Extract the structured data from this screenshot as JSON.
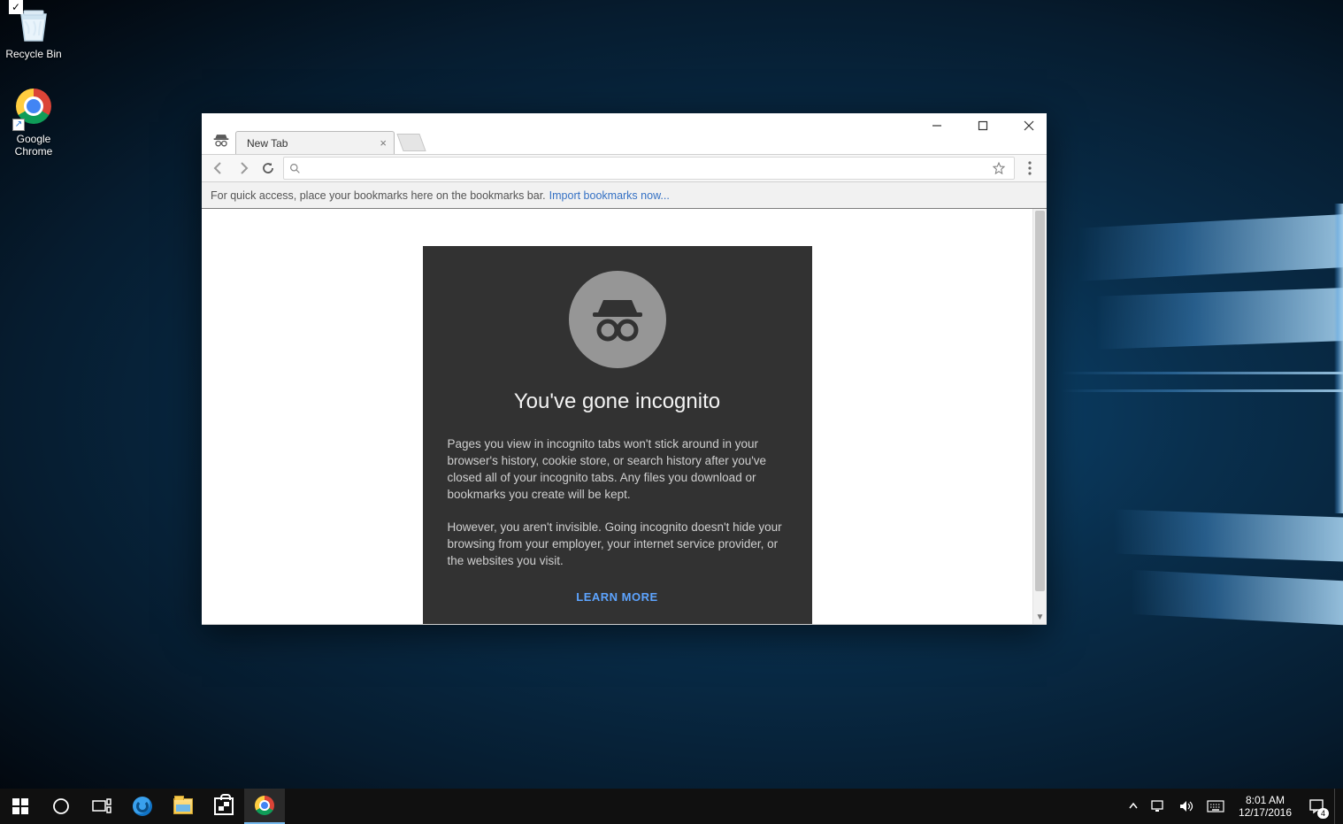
{
  "desktop": {
    "icons": [
      {
        "name": "recycle-bin",
        "label": "Recycle Bin"
      },
      {
        "name": "google-chrome",
        "label": "Google Chrome"
      }
    ]
  },
  "chrome": {
    "tab_title": "New Tab",
    "omnibox_value": "",
    "bookmarks_hint": "For quick access, place your bookmarks here on the bookmarks bar.",
    "bookmarks_link": "Import bookmarks now...",
    "incognito": {
      "title": "You've gone incognito",
      "p1": "Pages you view in incognito tabs won't stick around in your browser's history, cookie store, or search history after you've closed all of your incognito tabs. Any files you download or bookmarks you create will be kept.",
      "p2": "However, you aren't invisible. Going incognito doesn't hide your browsing from your employer, your internet service provider, or the websites you visit.",
      "learn_more": "LEARN MORE"
    }
  },
  "taskbar": {
    "time": "8:01 AM",
    "date": "12/17/2016",
    "notification_count": "4"
  }
}
